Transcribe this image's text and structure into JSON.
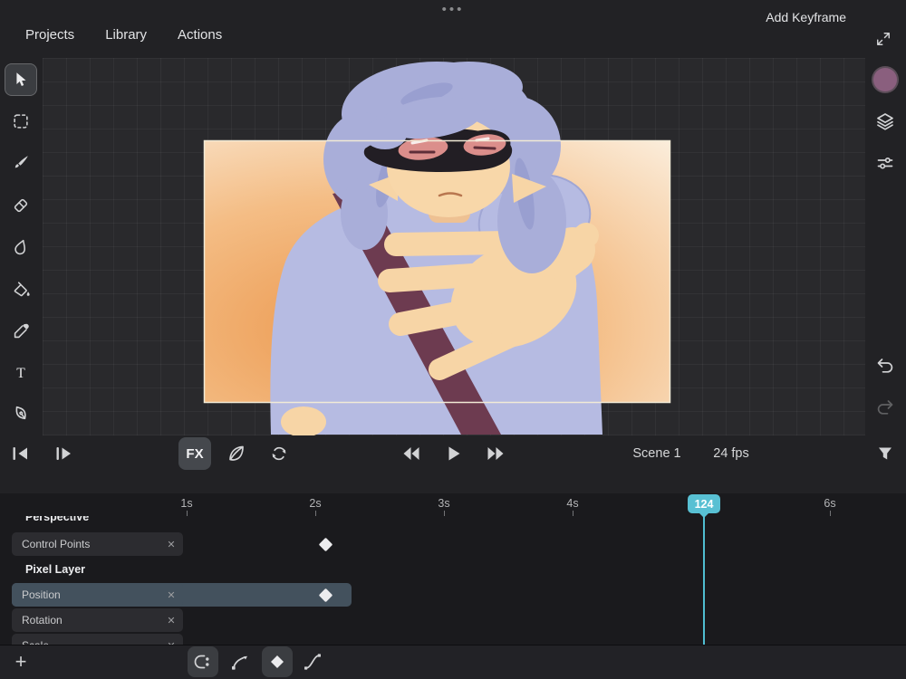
{
  "system": {
    "handle_dots": "•••"
  },
  "menu": {
    "items": [
      {
        "label": "Projects"
      },
      {
        "label": "Library"
      },
      {
        "label": "Actions"
      }
    ]
  },
  "tools": {
    "text_tool_glyph": "T"
  },
  "playbar": {
    "fx_label": "FX",
    "scene_label": "Scene 1",
    "fps_label": "24 fps"
  },
  "timeline": {
    "ruler_labels": [
      "1s",
      "2s",
      "3s",
      "4s",
      "6s"
    ],
    "playhead_frame": "124",
    "rows": [
      {
        "label": "Perspective",
        "kind": "group"
      },
      {
        "label": "Control Points",
        "kind": "property",
        "selected": false
      },
      {
        "label": "Pixel Layer",
        "kind": "group"
      },
      {
        "label": "Position",
        "kind": "property",
        "selected": true
      },
      {
        "label": "Rotation",
        "kind": "property",
        "selected": false
      },
      {
        "label": "Scale",
        "kind": "property",
        "selected": false,
        "clipped": true
      }
    ],
    "keyframes": [
      {
        "row": "Control Points",
        "time_s": 2.1
      },
      {
        "row": "Position",
        "time_s": 2.1
      }
    ]
  },
  "bottombar": {
    "plus_glyph": "+",
    "add_keyframe_label": "Add Keyframe"
  },
  "glyphs": {
    "close": "✕"
  },
  "colors": {
    "accent_teal": "#58c0d3",
    "selected_row": "#43515d",
    "color_swatch": "#8a5f7e",
    "canvas_bg": "#29292c",
    "panel_bg": "#222225"
  }
}
